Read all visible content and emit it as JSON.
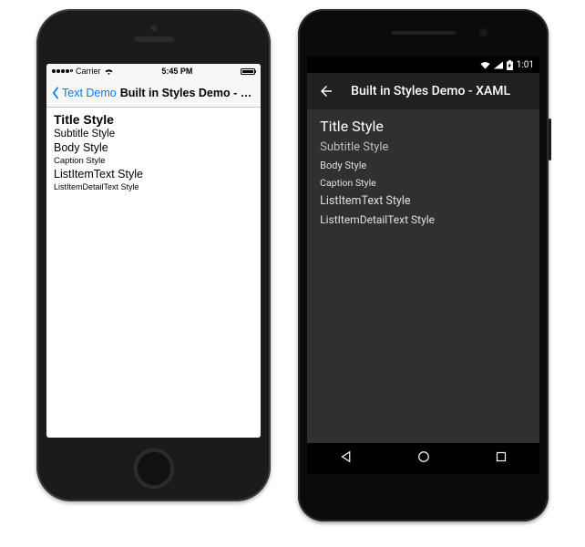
{
  "ios": {
    "status": {
      "carrier": "Carrier",
      "time": "5:45 PM",
      "wifi_icon": "wifi-icon"
    },
    "nav": {
      "back_label": "Text Demo",
      "title": "Built in Styles Demo - XAML"
    },
    "styles": [
      {
        "label": "Title Style",
        "class": "ios-title-style",
        "name": "title-style-text"
      },
      {
        "label": "Subtitle Style",
        "class": "ios-subtitle-style",
        "name": "subtitle-style-text"
      },
      {
        "label": "Body Style",
        "class": "ios-body-style",
        "name": "body-style-text"
      },
      {
        "label": "Caption Style",
        "class": "ios-caption-style",
        "name": "caption-style-text"
      },
      {
        "label": "ListItemText Style",
        "class": "ios-listitem-style",
        "name": "listitemtext-style-text"
      },
      {
        "label": "ListItemDetailText Style",
        "class": "ios-listitemdetail-style",
        "name": "listitemdetailtext-style-text"
      }
    ]
  },
  "android": {
    "status": {
      "time": "1:01"
    },
    "nav": {
      "title": "Built in Styles Demo - XAML"
    },
    "styles": [
      {
        "label": "Title Style",
        "class": "and-title-style",
        "name": "title-style-text"
      },
      {
        "label": "Subtitle Style",
        "class": "and-subtitle-style",
        "name": "subtitle-style-text"
      },
      {
        "label": "Body Style",
        "class": "and-body-style",
        "name": "body-style-text"
      },
      {
        "label": "Caption Style",
        "class": "and-caption-style",
        "name": "caption-style-text"
      },
      {
        "label": "ListItemText Style",
        "class": "and-listitem-style",
        "name": "listitemtext-style-text"
      },
      {
        "label": "ListItemDetailText Style",
        "class": "and-listitemdetail-style",
        "name": "listitemdetailtext-style-text"
      }
    ]
  }
}
